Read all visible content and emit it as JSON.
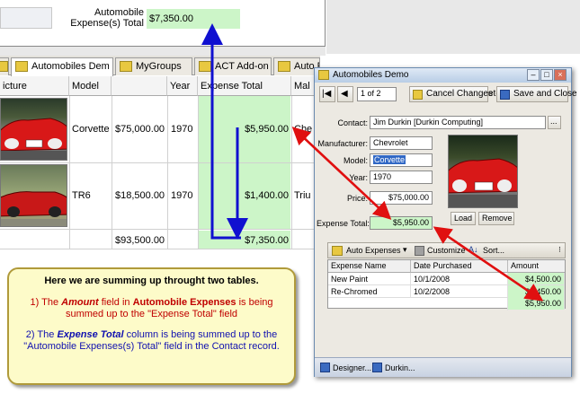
{
  "contact_card": {
    "label_line1": "Automobile",
    "label_line2": "Expense(s) Total",
    "value": "$7,350.00"
  },
  "tabs": [
    {
      "label": "Automobiles Dem",
      "active": true
    },
    {
      "label": "MyGroups",
      "active": false
    },
    {
      "label": "ACT Add-on",
      "active": false
    },
    {
      "label": "Auto F",
      "active": false
    }
  ],
  "grid": {
    "columns": [
      "icture",
      "Model",
      "",
      "Year",
      "Expense Total",
      "Mal"
    ],
    "rows": [
      {
        "model": "Corvette",
        "price": "$75,000.00",
        "year": "1970",
        "expense_total": "$5,950.00",
        "make": "Che"
      },
      {
        "model": "TR6",
        "price": "$18,500.00",
        "year": "1970",
        "expense_total": "$1,400.00",
        "make": "Triu"
      }
    ],
    "totals": {
      "price": "$93,500.00",
      "expense_total": "$7,350.00"
    }
  },
  "note": {
    "heading": "Here we are summing up throught two tables.",
    "p1_a": "1) The ",
    "p1_b": "Amount",
    "p1_c": " field in ",
    "p1_d": "Automobile Expenses",
    "p1_e": " is being summed up to the \"Expense Total\" field",
    "p2_a": "2) The ",
    "p2_b": "Expense Total",
    "p2_c": " column is being summed up to the \"Automobile Expenses(s) Total\" field  in the Contact record."
  },
  "dialog": {
    "title": "Automobiles Demo",
    "record_position": "1 of 2",
    "cancel_label": "Cancel Changes",
    "cancel_tail": "ete",
    "save_label": "Save and Close",
    "contact_label": "Contact:",
    "contact_value": "Jim Durkin [Durkin Computing]",
    "manufacturer_label": "Manufacturer:",
    "manufacturer_value": "Chevrolet",
    "model_label": "Model:",
    "model_value": "Corvette",
    "year_label": "Year:",
    "year_value": "1970",
    "price_label": "Price:",
    "price_value": "$75,000.00",
    "expense_total_label": "Expense Total:",
    "expense_total_value": "$5,950.00",
    "load_label": "Load",
    "remove_label": "Remove",
    "sub_toolbar": {
      "auto_expenses": "Auto Expenses",
      "customize": "Customize",
      "sort": "Sort..."
    },
    "sub_grid": {
      "columns": [
        "Expense Name",
        "Date Purchased",
        "Amount"
      ],
      "rows": [
        {
          "name": "New Paint",
          "date": "10/1/2008",
          "amount": "$4,500.00"
        },
        {
          "name": "Re-Chromed",
          "date": "10/2/2008",
          "amount": "$1,450.00"
        }
      ],
      "total": "$5,950.00"
    },
    "status": {
      "designer": "Designer...",
      "durkin": "Durkin..."
    }
  },
  "colors": {
    "highlight_green": "#ccf5c8",
    "arrow_blue": "#1010d0",
    "arrow_red": "#e01010",
    "note_bg": "#fdfbc9"
  }
}
